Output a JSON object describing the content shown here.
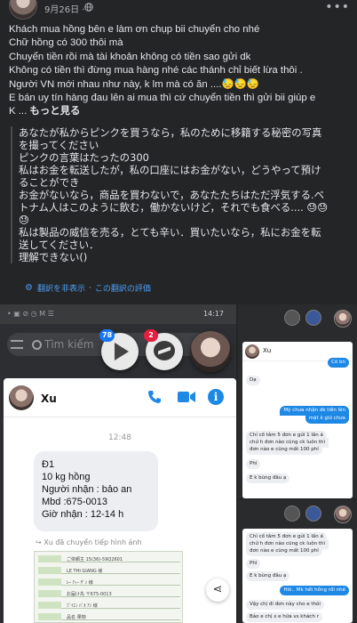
{
  "post": {
    "date": "9月26日",
    "date_separator": "·",
    "lines": [
      "Khách mua hồng bên e làm ơn chụp bii chuyển cho nhé",
      "Chữ hồng có 300 thôi mà",
      "Chuyển tiền rồi mà tài khoản không có tiền sao gửi dk",
      "   Không có tiền thì đừng mua hàng nhé các thánh chỉ biết lừa thôi .",
      "Người VN mới nhau như này, k lm mà có ăn ....😓😓😓",
      "E bán uy tín hàng đau lên ai mua thì cứ chuyển tiền thì gửi bii giúp e"
    ],
    "last_line_prefix": "K ... ",
    "see_more": "もっと見る"
  },
  "translation": {
    "lines": [
      "あなたが私からピンクを買うなら，私のために移籍する秘密の写真",
      "を撮ってください",
      "ピンクの言葉はたったの300",
      "私はお金を転送したが，私の口座にはお金がない，どうやって預け",
      "ることができ",
      "お金がないなら，商品を買わないで，あなたたちはただ浮気する.ベ",
      "トナム人はこのように飲む，働かないけど，それでも食べる.... 😓😓",
      "😓",
      "私は製品の威信を売る，とても辛い．買いたいなら，私にお金を転",
      "送してください．",
      "理解できない()"
    ],
    "hide_link": "翻訳を非表示",
    "separator": " · ",
    "rate_link": "この翻訳の評価"
  },
  "photo_main": {
    "status_time": "14:17",
    "status_left": "• ▣ ⊘ ◷ M ☰",
    "search_placeholder": "Tìm kiếm",
    "badge_play": "78",
    "badge_messenger": "2",
    "contact_name": "Xu",
    "chat_time": "12:48",
    "message_lines": [
      "Đ1",
      "10 kg hồng",
      "Người nhận : bảo an",
      "Mbd :675-0013",
      "Giờ nhận : 12-14 h"
    ],
    "forward_label": "Xu đã chuyển tiếp hình ảnh",
    "forward_rows": [
      "ご依頼主 15(36)-59Q2601",
      "LE THI GIANG 様",
      "ﾚｰ ﾃｨｰ ｻﾞﾝ 様",
      "お届け先 〒675-0013",
      "ﾌﾞｲｴﾝ ﾊﾞｵ ｱﾝ 様",
      "品名 果物"
    ]
  },
  "photo_right_1": {
    "contact_name": "Xu",
    "messages": [
      {
        "dir": "out",
        "text": "Có bn"
      },
      {
        "dir": "in",
        "text": "Dạ"
      },
      {
        "dir": "out",
        "text": "Mỹ chưa nhận dk tiền lên"
      },
      {
        "dir": "out",
        "text": "mặt k giữ chưa"
      },
      {
        "dir": "in",
        "text": "Chỉ cố tâm 5 đơn e gửi 1 lần á"
      },
      {
        "dir": "in",
        "text": "chứ h đơn nào cũng ck luôn thì"
      },
      {
        "dir": "in",
        "text": "đơn nào e cũng mất 100 phí"
      },
      {
        "dir": "in",
        "text": "Phí"
      },
      {
        "dir": "in",
        "text": "E k bùng đâu ạ"
      }
    ]
  },
  "photo_right_2": {
    "messages": [
      {
        "dir": "in",
        "text": "Chỉ cố tâm 5 đơn e gửi 1 lần á"
      },
      {
        "dir": "in",
        "text": "chứ h đơn nào cũng ck luôn thì"
      },
      {
        "dir": "in",
        "text": "đơn nào e cũng mất 100 phí"
      },
      {
        "dir": "in",
        "text": "Phí"
      },
      {
        "dir": "in",
        "text": "E k bùng đâu ạ"
      },
      {
        "dir": "out",
        "text": "Hôi.. Mk hết hồng rồi nhé"
      },
      {
        "dir": "in",
        "text": "Vậy chị đi đơn này cho e thôi"
      },
      {
        "dir": "in",
        "text": "Bảo e chị x e hứa vs khách r"
      }
    ]
  },
  "colors": {
    "background": "#242526",
    "text": "#e4e6eb",
    "muted": "#b0b3b8",
    "link": "#4a9ef7",
    "messenger_blue": "#1e88e5",
    "badge_red": "#e41e3f"
  }
}
